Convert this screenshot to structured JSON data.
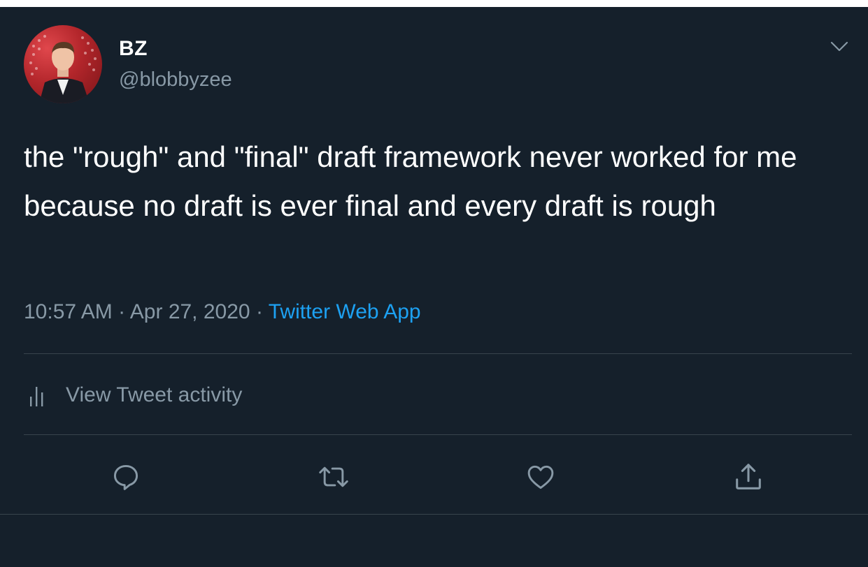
{
  "tweet": {
    "display_name": "BZ",
    "handle": "@blobbyzee",
    "text": "the \"rough\" and \"final\" draft framework never worked for me because no draft is ever final and every draft is rough",
    "time": "10:57 AM",
    "separator": "·",
    "date": "Apr 27, 2020",
    "source": "Twitter Web App"
  },
  "activity": {
    "label": "View Tweet activity",
    "icon": "bar-chart-icon"
  },
  "actions": [
    {
      "name": "reply",
      "icon": "reply-icon"
    },
    {
      "name": "retweet",
      "icon": "retweet-icon"
    },
    {
      "name": "like",
      "icon": "heart-icon"
    },
    {
      "name": "share",
      "icon": "share-icon"
    }
  ],
  "colors": {
    "background": "#15202b",
    "primary_text": "#ffffff",
    "secondary_text": "#8899a6",
    "accent": "#1da1f2",
    "divider": "#38444d"
  }
}
